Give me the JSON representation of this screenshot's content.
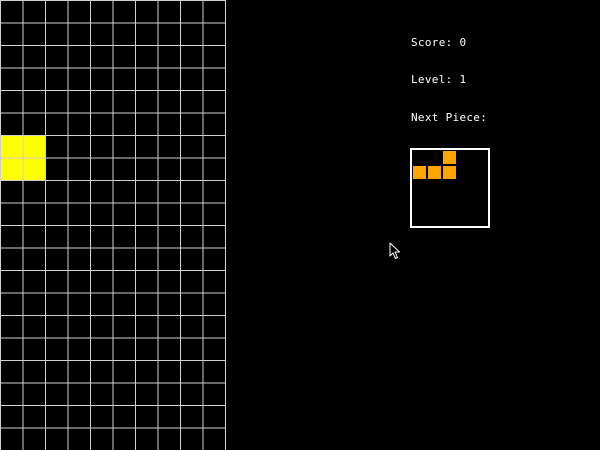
{
  "hud": {
    "score_label": "Score:",
    "score_value": "0",
    "level_label": "Level:",
    "level_value": "1",
    "next_piece_label": "Next Piece:"
  },
  "board": {
    "columns": 10,
    "visible_rows": 20,
    "grid_color": "#cfcfcf",
    "background": "#000000",
    "active_piece": {
      "shape": "O",
      "color": "#ffff00",
      "cells": [
        [
          0,
          6
        ],
        [
          1,
          6
        ],
        [
          0,
          7
        ],
        [
          1,
          7
        ]
      ]
    }
  },
  "next_piece": {
    "shape": "L",
    "color": "#ffa500",
    "cells": [
      [
        2,
        0
      ],
      [
        0,
        1
      ],
      [
        1,
        1
      ],
      [
        2,
        1
      ]
    ]
  },
  "colors": {
    "background": "#000000",
    "text": "#ffffff",
    "o_piece": "#ffff00",
    "l_piece": "#ffa500"
  }
}
